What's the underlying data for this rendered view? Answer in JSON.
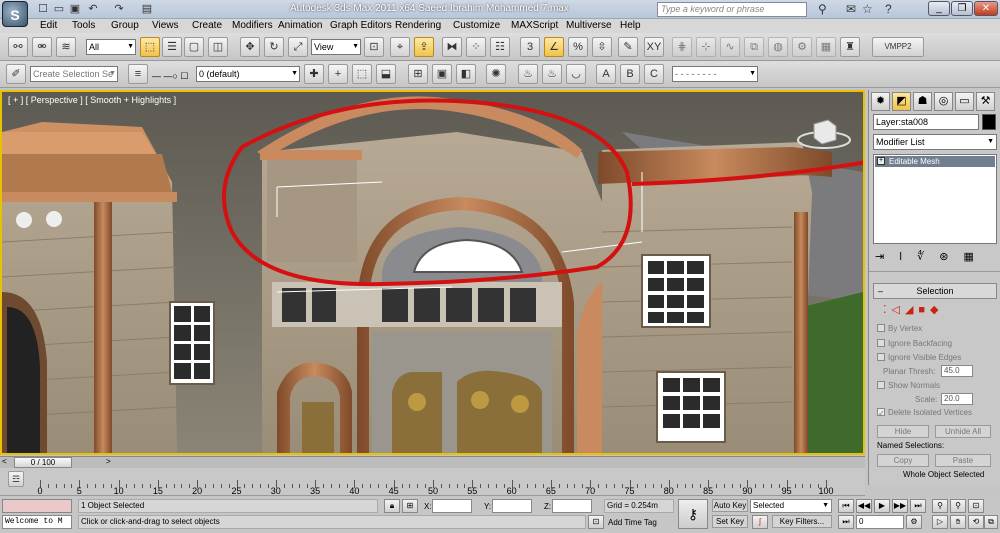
{
  "window": {
    "title": "Autodesk 3ds Max  2011 x64      Saeed Ibrahim Mohammed 7.max",
    "logo_letter": "S"
  },
  "quick_access": [
    "new-icon",
    "open-icon",
    "save-icon",
    "undo-icon",
    "redo-icon",
    "project-icon"
  ],
  "search": {
    "placeholder": "Type a keyword or phrase"
  },
  "menu": [
    "Edit",
    "Tools",
    "Group",
    "Views",
    "Create",
    "Modifiers",
    "Animation",
    "Graph Editors",
    "Rendering",
    "Customize",
    "MAXScript",
    "Multiverse",
    "Help"
  ],
  "toolbar1": {
    "filter_select": "All",
    "ref_coord_select": "View",
    "vmpp_label": "VMPP2",
    "snap_label": "3",
    "percent_label": "%",
    "xy_label": "XY"
  },
  "toolbar2": {
    "selection_set_placeholder": "Create Selection Se",
    "layer_select": "0 (default)",
    "abc_label": "A",
    "b_label": "B",
    "c_label": "C"
  },
  "viewport": {
    "label": "[ + ] [ Perspective ] [ Smooth + Highlights ]"
  },
  "command_panel": {
    "object_name": "Layer:sta008",
    "modifier_list": "Modifier List",
    "stack_item": "Editable Mesh",
    "selection_rollout": "Selection",
    "by_vertex": "By Vertex",
    "ignore_backfacing": "Ignore Backfacing",
    "ignore_visible_edges": "Ignore Visible Edges",
    "planar_thresh_label": "Planar Thresh:",
    "planar_thresh": "45.0",
    "show_normals": "Show Normals",
    "scale_label": "Scale:",
    "scale_value": "20.0",
    "delete_isolated": "Delete Isolated Vertices",
    "hide_btn": "Hide",
    "unhide_all_btn": "Unhide All",
    "named_selections": "Named Selections:",
    "copy_btn": "Copy",
    "paste_btn": "Paste",
    "whole_object_selected": "Whole Object Selected"
  },
  "timeline": {
    "slider_label": "0 / 100",
    "ticks": [
      "0",
      "5",
      "10",
      "15",
      "20",
      "25",
      "30",
      "35",
      "40",
      "45",
      "50",
      "55",
      "60",
      "65",
      "70",
      "75",
      "80",
      "85",
      "90",
      "95",
      "100"
    ]
  },
  "status": {
    "maxscript_listener": "",
    "welcome": "Welcome to M",
    "objects_selected": "1 Object Selected",
    "prompt": "Click or click-and-drag to select objects",
    "x_label": "X:",
    "y_label": "Y:",
    "z_label": "Z:",
    "x_value": "",
    "y_value": "",
    "z_value": "",
    "grid": "Grid = 0.254m",
    "add_time_tag": "Add Time Tag",
    "auto_key": "Auto Key",
    "set_key": "Set Key",
    "selected_dropdown": "Selected",
    "key_filters": "Key Filters...",
    "frame": "0"
  },
  "colors": {
    "viewport_border": "#e8c100",
    "annotation_red": "#d41010",
    "active_button": "#f0c24a"
  }
}
